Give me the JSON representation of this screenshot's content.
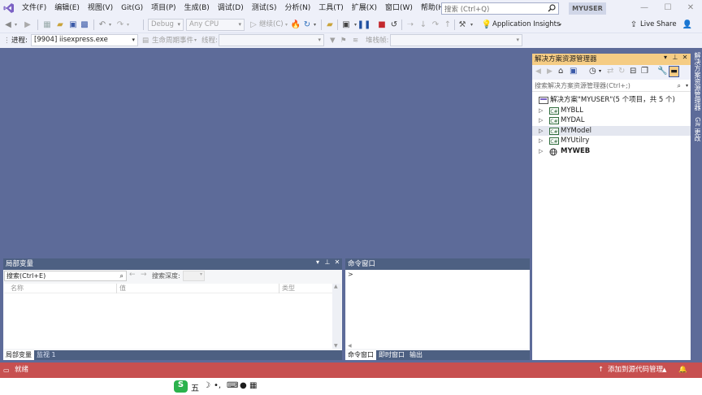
{
  "menu": {
    "items": [
      "文件(F)",
      "编辑(E)",
      "视图(V)",
      "Git(G)",
      "项目(P)",
      "生成(B)",
      "调试(D)",
      "测试(S)",
      "分析(N)",
      "工具(T)",
      "扩展(X)",
      "窗口(W)",
      "帮助(H)"
    ],
    "search_placeholder": "搜索 (Ctrl+Q)",
    "user": "MYUSER"
  },
  "toolbar": {
    "config": "Debug",
    "platform": "Any CPU",
    "continue": "继续(C)",
    "app_insights": "Application Insights",
    "live_share": "Live Share",
    "process_label": "进程:",
    "process_value": "[9904] iisexpress.exe",
    "lifecycle_label": "生命周期事件",
    "thread_label": "线程:",
    "stack_label": "堆栈帧:"
  },
  "locals_panel": {
    "title": "局部变量",
    "search_placeholder": "搜索(Ctrl+E)",
    "search_depth_label": "搜索深度:",
    "columns": [
      "名称",
      "值",
      "类型"
    ],
    "tabs": [
      "局部变量",
      "监视 1"
    ]
  },
  "command_panel": {
    "title": "命令窗口",
    "prompt": ">",
    "tabs": [
      "命令窗口",
      "即时窗口",
      "输出"
    ]
  },
  "solution_explorer": {
    "title": "解决方案资源管理器",
    "search_placeholder": "搜索解决方案资源管理器(Ctrl+;)",
    "root": "解决方案\"MYUSER\"(5 个项目，共 5 个)",
    "projects": [
      {
        "name": "MYBLL",
        "bold": false
      },
      {
        "name": "MYDAL",
        "bold": false
      },
      {
        "name": "MYModel",
        "bold": false
      },
      {
        "name": "MYUtilry",
        "bold": false
      },
      {
        "name": "MYWEB",
        "bold": true
      }
    ]
  },
  "side_tabs": [
    "解决方案资源管理器",
    "Git 更改"
  ],
  "status": {
    "left": "就绪",
    "source_control": "添加到源代码管理"
  },
  "ime": {
    "mode": "五"
  },
  "colors": {
    "workspace": "#5d6b99",
    "statusbar": "#c75050",
    "panel_title": "#4d6082",
    "active_title": "#f5cc84"
  }
}
